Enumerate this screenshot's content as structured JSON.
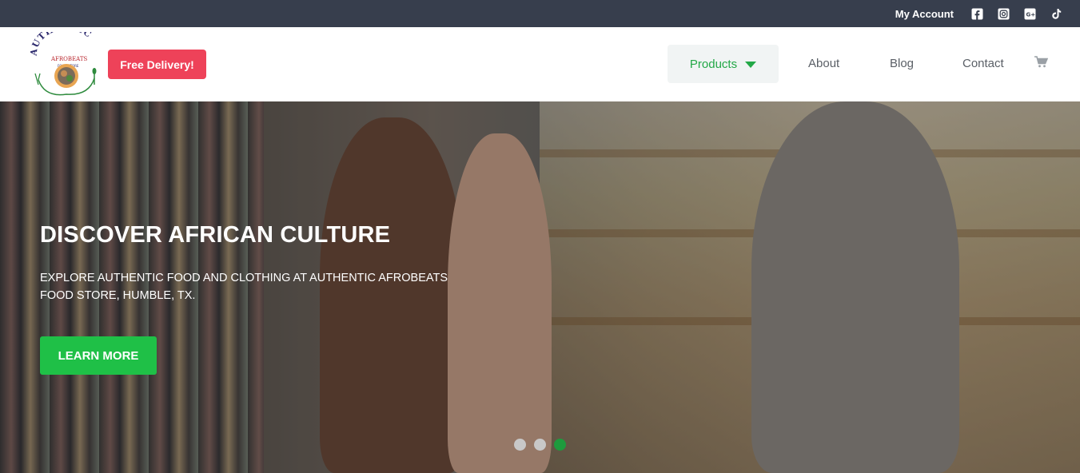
{
  "topbar": {
    "my_account": "My Account",
    "social_icons": [
      "facebook-icon",
      "instagram-icon",
      "google-plus-icon",
      "tiktok-icon"
    ]
  },
  "header": {
    "logo_text": "AUTHENTIC AFROBEATS FOOD STORE",
    "free_delivery": "Free Delivery!",
    "nav": {
      "products": "Products",
      "about": "About",
      "blog": "Blog",
      "contact": "Contact"
    },
    "cart_icon": "cart-icon"
  },
  "hero": {
    "title": "DISCOVER AFRICAN CULTURE",
    "subtitle": "EXPLORE AUTHENTIC FOOD AND CLOTHING AT AUTHENTIC AFROBEATS FOOD STORE, HUMBLE, TX.",
    "cta": "LEARN MORE",
    "slides": 3,
    "active_slide": 3
  },
  "colors": {
    "topbar_bg": "#373e4d",
    "accent_green": "#1fc047",
    "delivery_red": "#ee4259",
    "nav_active": "#23a847"
  }
}
